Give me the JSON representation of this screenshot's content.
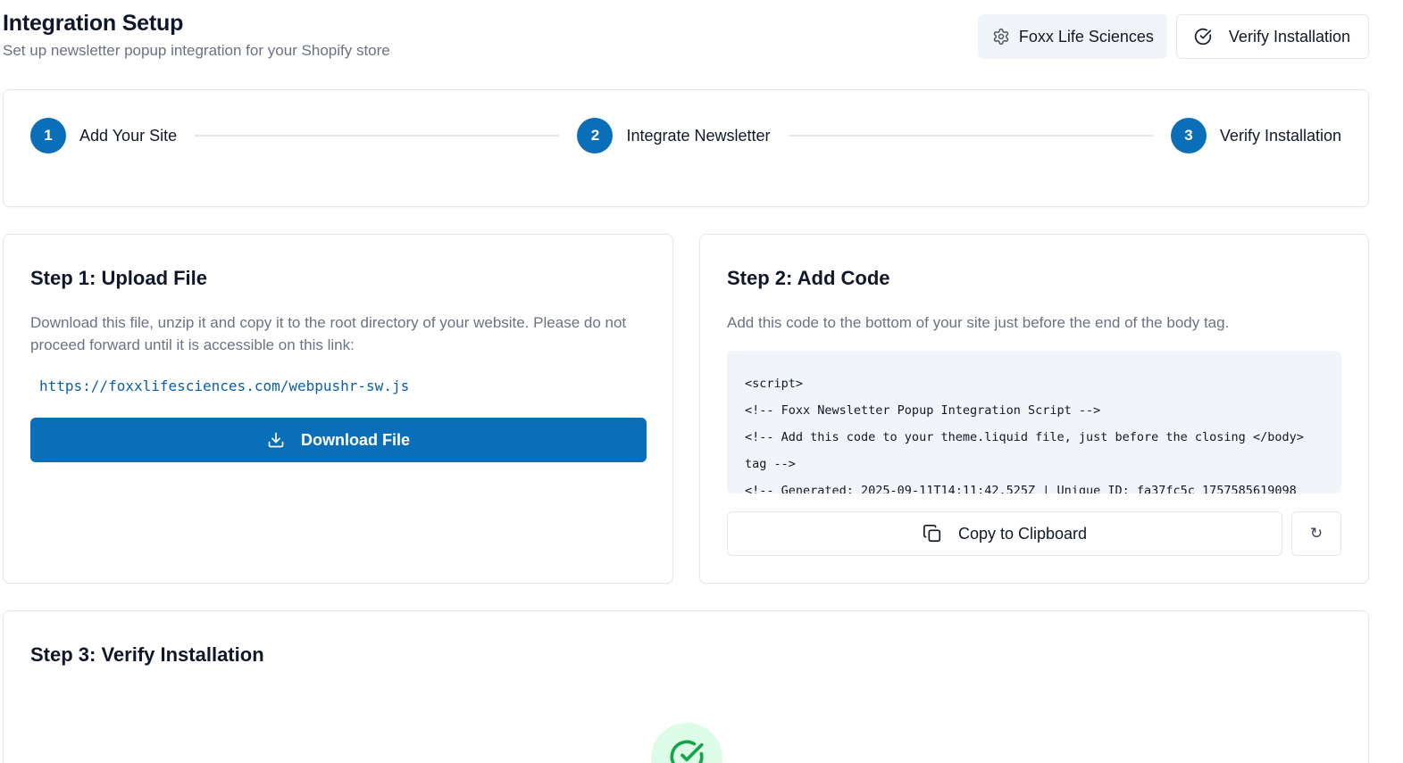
{
  "header": {
    "title": "Integration Setup",
    "subtitle": "Set up newsletter popup integration for your Shopify store",
    "store_button_label": "Foxx Life Sciences",
    "verify_button_label": "Verify Installation"
  },
  "stepper": {
    "steps": [
      {
        "number": "1",
        "label": "Add Your Site"
      },
      {
        "number": "2",
        "label": "Integrate Newsletter"
      },
      {
        "number": "3",
        "label": "Verify Installation"
      }
    ]
  },
  "step1": {
    "title": "Step 1: Upload File",
    "description": "Download this file, unzip it and copy it to the root directory of your website. Please do not proceed forward until it is accessible on this link:",
    "file_url": "https://foxxlifesciences.com/webpushr-sw.js",
    "download_label": "Download File"
  },
  "step2": {
    "title": "Step 2: Add Code",
    "description": "Add this code to the bottom of your site just before the end of the body tag.",
    "code_lines": [
      "<script>",
      "<!-- Foxx Newsletter Popup Integration Script -->",
      "<!-- Add this code to your theme.liquid file, just before the closing </body>",
      "tag -->",
      "<!-- Generated: 2025-09-11T14:11:42.525Z | Unique ID: fa37fc5c_1757585619098"
    ],
    "copy_label": "Copy to Clipboard",
    "refresh_glyph": "↻"
  },
  "step3": {
    "title": "Step 3: Verify Installation"
  },
  "colors": {
    "primary": "#0a6fb8",
    "success_bg": "#dcfce7",
    "success_fg": "#16a34a",
    "muted_text": "#6b7280",
    "border": "#e5e7eb"
  }
}
